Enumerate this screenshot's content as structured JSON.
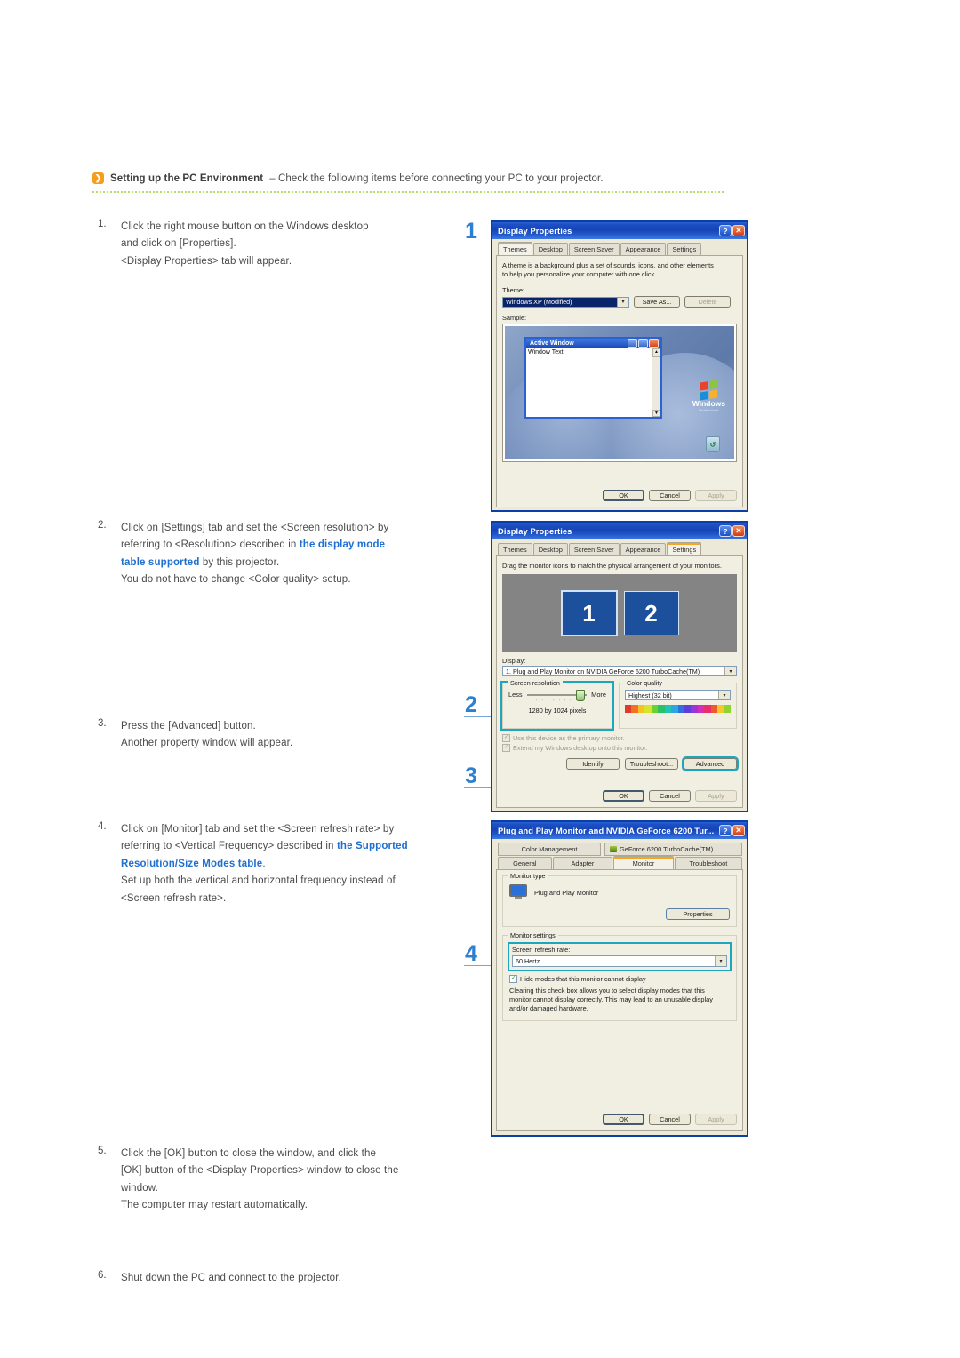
{
  "header": {
    "bullet_icon": "chevron-right-icon",
    "title": "Setting up the PC Environment",
    "subtitle": "– Check the following items before connecting your PC to your projector."
  },
  "steps": [
    {
      "num": "1.",
      "lines": [
        "Click the right mouse button on the Windows desktop",
        "and click on [Properties].",
        "<Display Properties> tab will appear."
      ]
    },
    {
      "num": "2.",
      "line1a": "Click on [Settings] tab and set the <Screen resolution> by",
      "line2a": "referring to <Resolution> described in ",
      "link1": "the display mode",
      "link2": "table supported",
      "line3a": " by this projector.",
      "line4": "You do not have to change <Color quality> setup."
    },
    {
      "num": "3.",
      "lines": [
        "Press the [Advanced] button.",
        "Another property window will appear."
      ]
    },
    {
      "num": "4.",
      "line1a": "Click on [Monitor] tab and set the <Screen refresh rate> by",
      "line2a": "referring to <Vertical Frequency> described in ",
      "link1": "the Supported",
      "link2": "Resolution/Size Modes table",
      "line3a": ".",
      "line4": "Set up both the vertical and horizontal frequency instead of",
      "line5": "<Screen refresh rate>."
    },
    {
      "num": "5.",
      "lines": [
        "Click the [OK] button to close the window, and click the",
        "[OK] button of the <Display Properties> window to close the",
        "window.",
        "The computer may restart automatically."
      ]
    },
    {
      "num": "6.",
      "lines": [
        "Shut down the PC and connect to the projector."
      ]
    }
  ],
  "callouts": {
    "one": "1",
    "two": "2",
    "three": "3",
    "four": "4"
  },
  "dialog1": {
    "title": "Display Properties",
    "help_btn": "?",
    "close_btn": "✕",
    "tabs": [
      "Themes",
      "Desktop",
      "Screen Saver",
      "Appearance",
      "Settings"
    ],
    "active_tab": "Themes",
    "desc_line1": "A theme is a background plus a set of sounds, icons, and other elements",
    "desc_line2": "to help you personalize your computer with one click.",
    "theme_label": "Theme:",
    "theme_value": "Windows XP (Modified)",
    "save_as_btn": "Save As...",
    "delete_btn": "Delete",
    "sample_label": "Sample:",
    "sample_window_title": "Active Window",
    "sample_window_text": "Window Text",
    "sample_logo": "Windows",
    "sample_logo_sub": "Professional",
    "recycle_icon": "recycle-bin-icon",
    "ok_btn": "OK",
    "cancel_btn": "Cancel",
    "apply_btn": "Apply"
  },
  "dialog2": {
    "title": "Display Properties",
    "help_btn": "?",
    "close_btn": "✕",
    "tabs": [
      "Themes",
      "Desktop",
      "Screen Saver",
      "Appearance",
      "Settings"
    ],
    "active_tab": "Settings",
    "drag_text": "Drag the monitor icons to match the physical arrangement of your monitors.",
    "monitor1": "1",
    "monitor2": "2",
    "display_label": "Display:",
    "display_value": "1. Plug and Play Monitor on NVIDIA GeForce 6200 TurboCache(TM)",
    "screen_resolution_group": "Screen resolution",
    "less_label": "Less",
    "more_label": "More",
    "resolution_value": "1280 by 1024 pixels",
    "color_quality_group": "Color quality",
    "color_quality_value": "Highest (32 bit)",
    "chk_primary": "Use this device as the primary monitor.",
    "chk_extend": "Extend my Windows desktop onto this monitor.",
    "identify_btn": "Identify",
    "troubleshoot_btn": "Troubleshoot...",
    "advanced_btn": "Advanced",
    "ok_btn": "OK",
    "cancel_btn": "Cancel",
    "apply_btn": "Apply"
  },
  "dialog3": {
    "title": "Plug and Play Monitor and NVIDIA GeForce 6200 Tur...",
    "help_btn": "?",
    "close_btn": "✕",
    "tabs_row1": [
      "Color Management",
      "GeForce 6200 TurboCache(TM)"
    ],
    "tabs_row2": [
      "General",
      "Adapter",
      "Monitor",
      "Troubleshoot"
    ],
    "active_tab": "Monitor",
    "nvidia_icon": "nvidia-logo-icon",
    "monitor_type_group": "Monitor type",
    "monitor_icon": "monitor-icon",
    "monitor_type_value": "Plug and Play Monitor",
    "properties_btn": "Properties",
    "monitor_settings_group": "Monitor settings",
    "refresh_rate_label": "Screen refresh rate:",
    "refresh_rate_value": "60 Hertz",
    "hide_modes_chk": "Hide modes that this monitor cannot display",
    "warn_line1": "Clearing this check box allows you to select display modes that this",
    "warn_line2": "monitor cannot display correctly. This may lead to an unusable display",
    "warn_line3": "and/or damaged hardware.",
    "ok_btn": "OK",
    "cancel_btn": "Cancel",
    "apply_btn": "Apply"
  },
  "colors": {
    "accent_blue": "#1f6fd0",
    "callout_blue": "#2f7fd0",
    "bullet_orange": "#f59e1b",
    "rule_green": "#b9d96a",
    "xp_titlebar": "#1644b6",
    "xp_face": "#ece9d8",
    "highlight_teal": "#1da6bd"
  }
}
